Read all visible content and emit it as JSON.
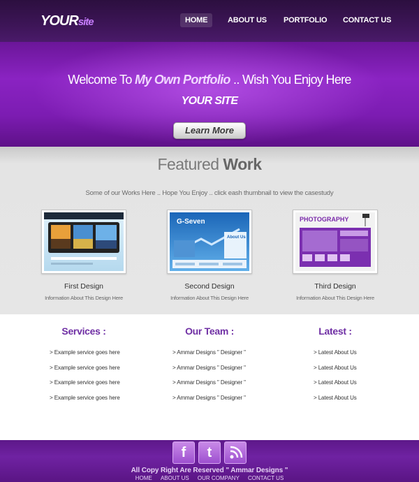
{
  "header": {
    "logo": {
      "part1": "YOUR",
      "part2": "site"
    },
    "nav": [
      "HOME",
      "ABOUT US",
      "PORTFOLIO",
      "CONTACT US"
    ],
    "active": "HOME"
  },
  "hero": {
    "title_pre": "Welcome To ",
    "title_em": "My Own Portfolio",
    "title_post": " .. Wish You Enjoy Here",
    "subtitle": "YOUR SITE",
    "button": "Learn More"
  },
  "featured": {
    "title_light": "Featured ",
    "title_bold": "Work",
    "description": "Some of our Works Here .. Hope You Enjoy .. click eash thumbnail to view the casestudy",
    "items": [
      {
        "title": "First Design",
        "info": "Information About This Design Here"
      },
      {
        "title": "Second Design",
        "info": "Information About This Design Here",
        "thumb_heading": "G-Seven",
        "thumb_box": "About Us"
      },
      {
        "title": "Third Design",
        "info": "Information About This Design Here",
        "thumb_heading": "PHOTOGRAPHY"
      }
    ]
  },
  "columns": {
    "services": {
      "title": "Services :",
      "items": [
        "> Example service goes here",
        "> Example service goes here",
        "> Example service goes here",
        "> Example service goes here"
      ]
    },
    "team": {
      "title": "Our Team :",
      "items": [
        "> Ammar Designs \" Designer \"",
        "> Ammar Designs \" Designer \"",
        "> Ammar Designs \" Designer \"",
        "> Ammar Designs \" Designer \""
      ]
    },
    "latest": {
      "title": "Latest :",
      "items": [
        "> Latest About Us",
        "> Latest About Us",
        "> Latest About Us",
        "> Latest About Us"
      ]
    }
  },
  "footer": {
    "social": [
      "facebook-icon",
      "twitter-icon",
      "rss-icon"
    ],
    "copyright": "All Copy Right Are Reserved \" Ammar Designs \"",
    "links": [
      "HOME",
      "ABOUT US",
      "OUR COMPANY",
      "CONTACT US"
    ]
  },
  "colors": {
    "brand_purple": "#7c1cb2",
    "dark_header": "#3d1557",
    "accent_text": "#6f2fa4"
  }
}
